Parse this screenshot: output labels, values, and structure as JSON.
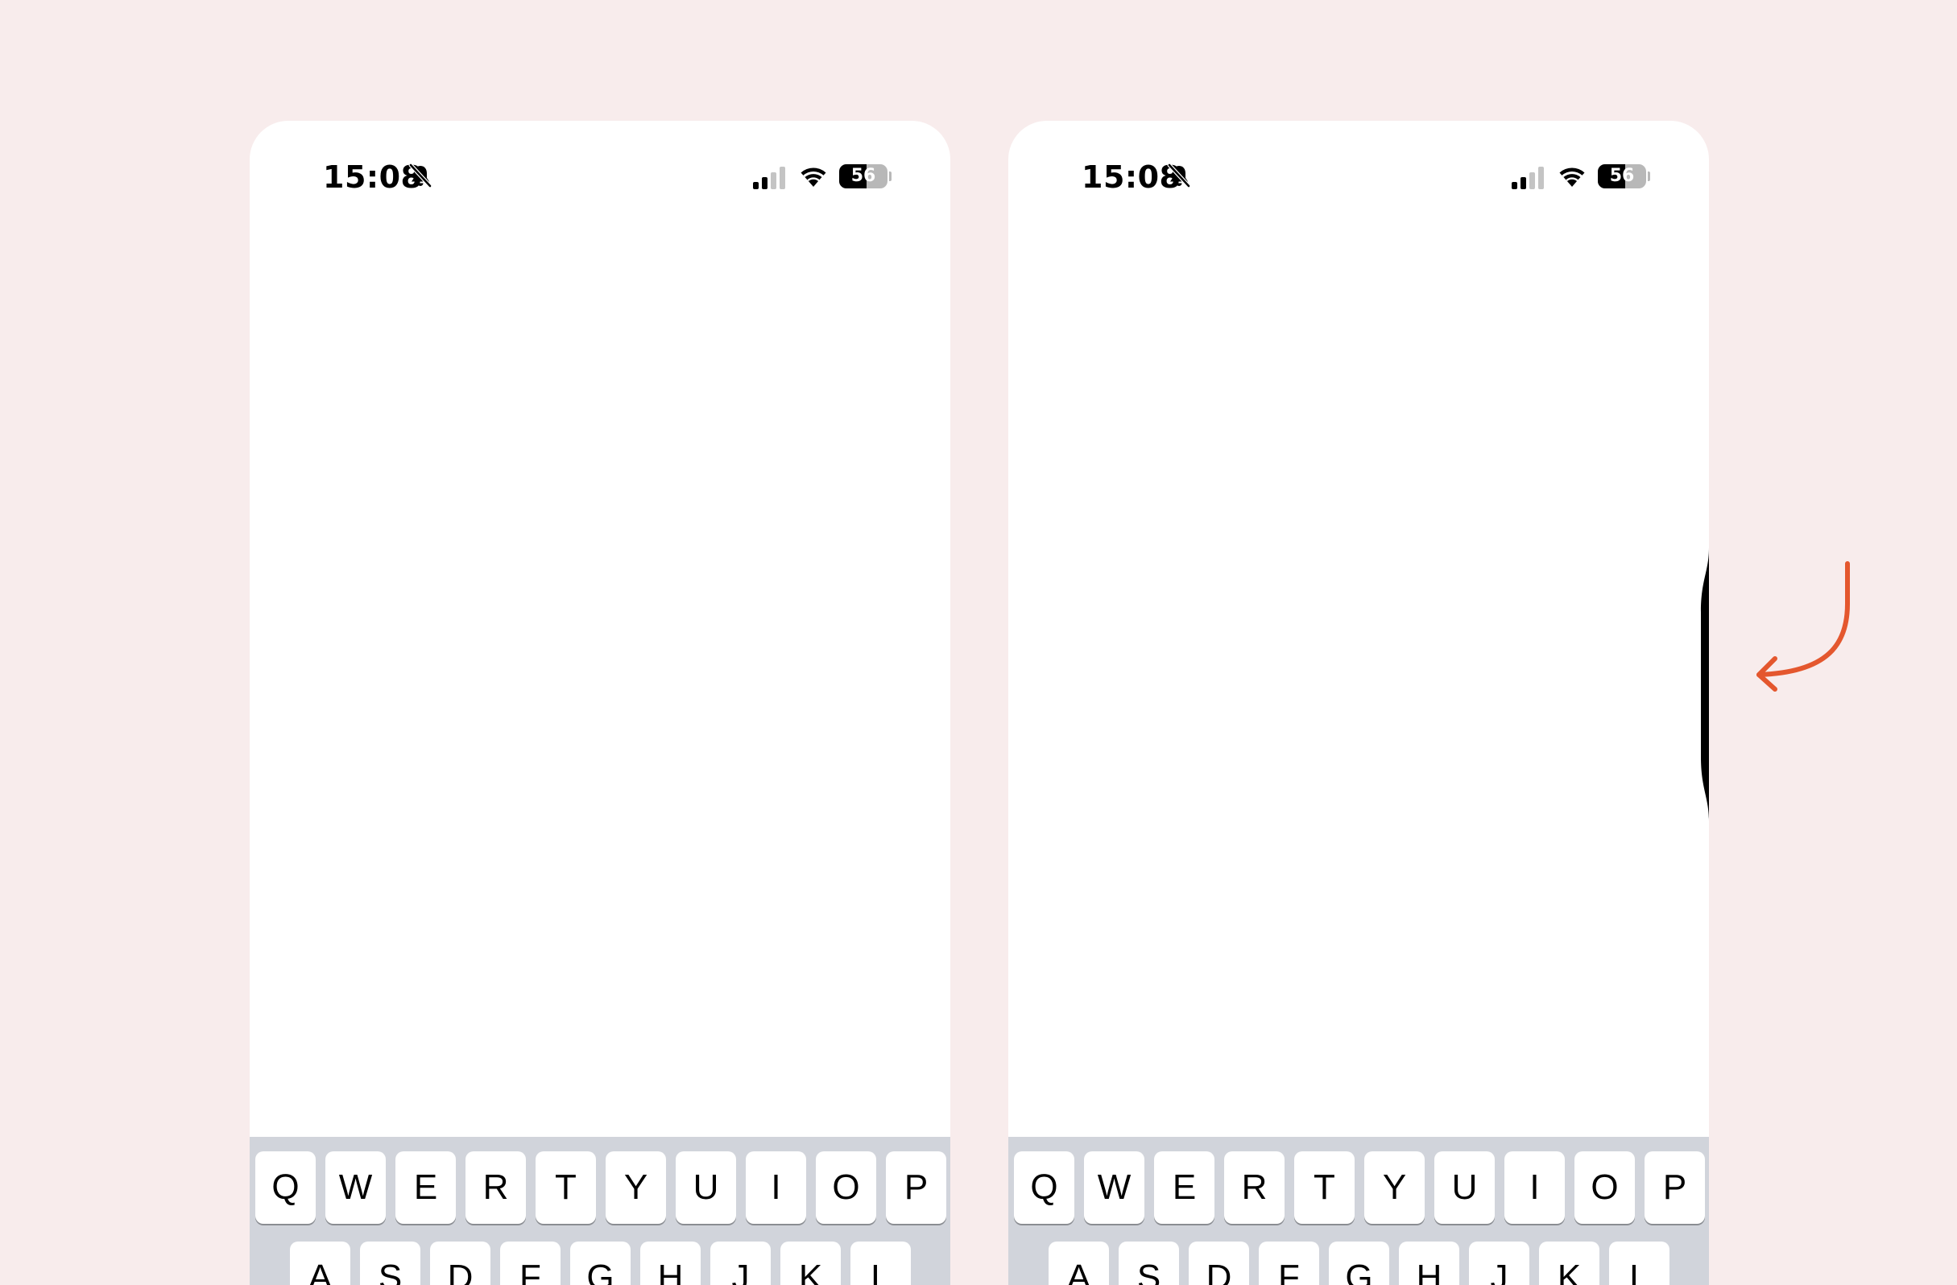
{
  "screens": [
    {
      "id": "left",
      "status_bar": {
        "time": "15:08",
        "battery_level": "56",
        "battery_percent": 56,
        "signal_bars_active": 2,
        "signal_bars_total": 4
      },
      "keyboard": {
        "row1": [
          "Q",
          "W",
          "E",
          "R",
          "T",
          "Y",
          "U",
          "I",
          "O",
          "P"
        ],
        "row2": [
          "A",
          "S",
          "D",
          "F",
          "G",
          "H",
          "J",
          "K",
          "L"
        ]
      }
    },
    {
      "id": "right",
      "status_bar": {
        "time": "15:08",
        "battery_level": "56",
        "battery_percent": 56,
        "signal_bars_active": 2,
        "signal_bars_total": 4
      },
      "keyboard": {
        "row1": [
          "Q",
          "W",
          "E",
          "R",
          "T",
          "Y",
          "U",
          "I",
          "O",
          "P"
        ],
        "row2": [
          "A",
          "S",
          "D",
          "F",
          "G",
          "H",
          "J",
          "K",
          "L"
        ]
      },
      "edge_indicator": true
    }
  ],
  "icons": {
    "mute": "bell-slash-icon",
    "signal": "cellular-signal-icon",
    "wifi": "wifi-icon",
    "battery": "battery-icon",
    "annotation": "curved-arrow-icon"
  },
  "colors": {
    "page_background": "#f8ecec",
    "keyboard_background": "#d1d4db",
    "key_background": "#ffffff",
    "annotation_arrow": "#e4572e"
  }
}
